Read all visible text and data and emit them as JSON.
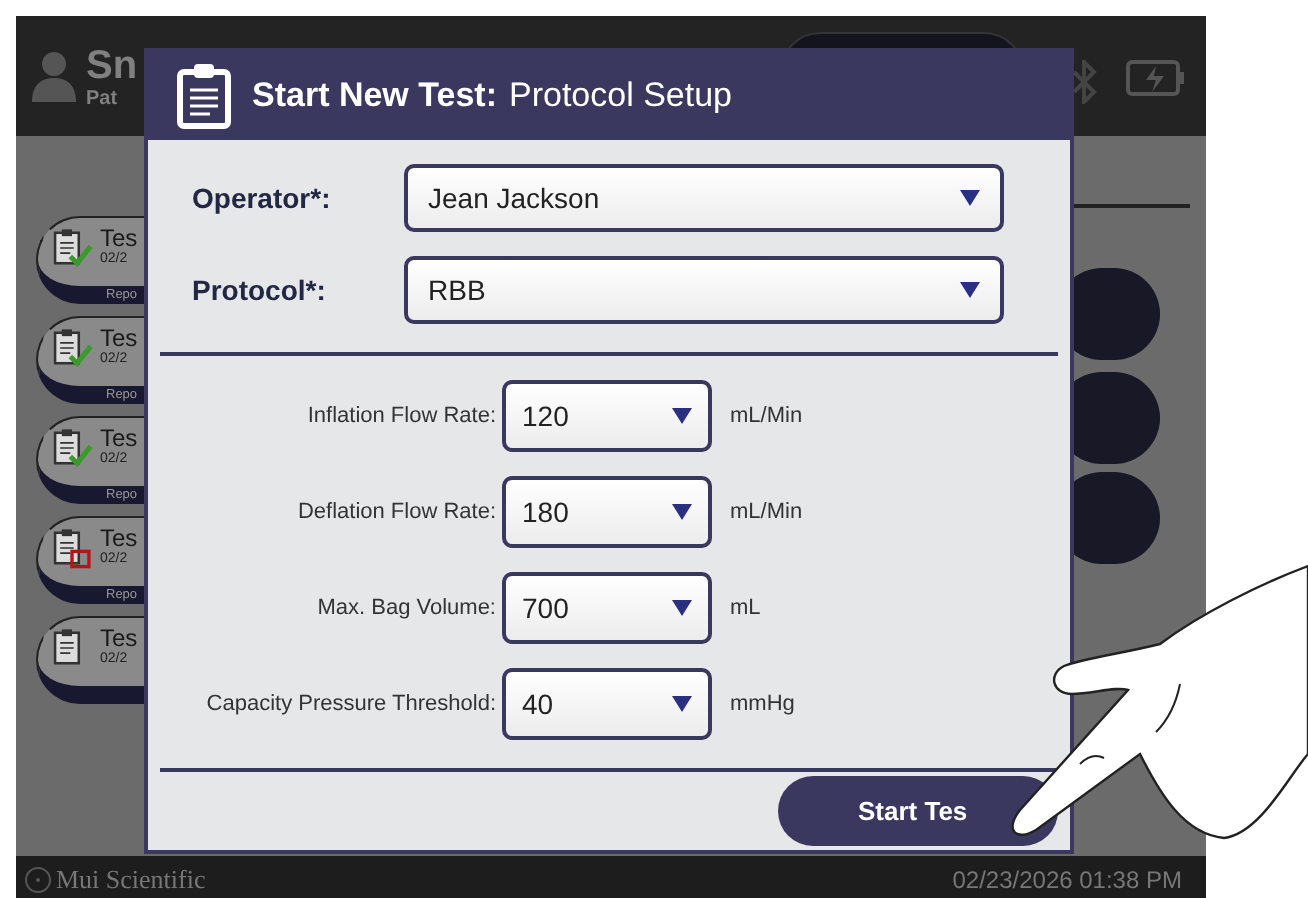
{
  "top_bar": {
    "user_name": "Sn",
    "user_subtitle": "Pat"
  },
  "cards": [
    {
      "title": "Tes",
      "date": "02/2",
      "footer": "Repo",
      "kind": "passed"
    },
    {
      "title": "Tes",
      "date": "02/2",
      "footer": "Repo",
      "kind": "passed"
    },
    {
      "title": "Tes",
      "date": "02/2",
      "footer": "Repo",
      "kind": "passed"
    },
    {
      "title": "Tes",
      "date": "02/2",
      "footer": "Repo",
      "kind": "failed"
    },
    {
      "title": "Tes",
      "date": "02/2",
      "kind": "none"
    }
  ],
  "footer": {
    "brand": "Mui Scientific",
    "datetime": "02/23/2026 01:38 PM"
  },
  "dialog": {
    "title": "Start New Test:",
    "subtitle": "Protocol Setup",
    "fields": [
      {
        "label": "Operator*:",
        "value": "Jean Jackson"
      },
      {
        "label": "Protocol*:",
        "value": "RBB"
      }
    ],
    "parameters": [
      {
        "label": "Inflation Flow Rate:",
        "value": "120",
        "unit": "mL/Min"
      },
      {
        "label": "Deflation Flow Rate:",
        "value": "180",
        "unit": "mL/Min"
      },
      {
        "label": "Max. Bag Volume:",
        "value": "700",
        "unit": "mL"
      },
      {
        "label": "Capacity Pressure Threshold:",
        "value": "40",
        "unit": "mmHg"
      }
    ],
    "button": "Start Tes"
  }
}
